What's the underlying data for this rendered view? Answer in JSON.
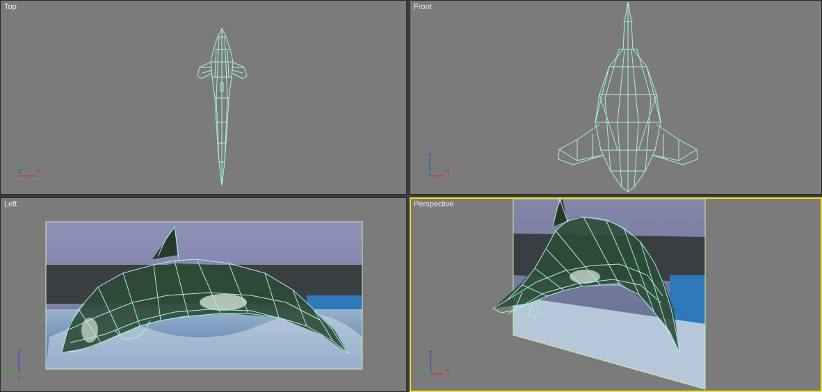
{
  "viewports": {
    "top": {
      "label": "Top",
      "axes": [
        "y",
        "z",
        "x"
      ]
    },
    "front": {
      "label": "Front",
      "axes": [
        "z",
        "y",
        "x"
      ]
    },
    "left": {
      "label": "Left",
      "axes": [
        "z",
        "y",
        "x"
      ]
    },
    "perspective": {
      "label": "Perspective",
      "axes": [
        "z",
        "y",
        "x"
      ],
      "active": true
    }
  },
  "colors": {
    "viewport_bg": "#7b7b7b",
    "wireframe": "#a8f5dc",
    "active_border": "#f6e21a",
    "axis_x": "#e02020",
    "axis_y": "#20c020",
    "axis_z": "#2040e0"
  }
}
